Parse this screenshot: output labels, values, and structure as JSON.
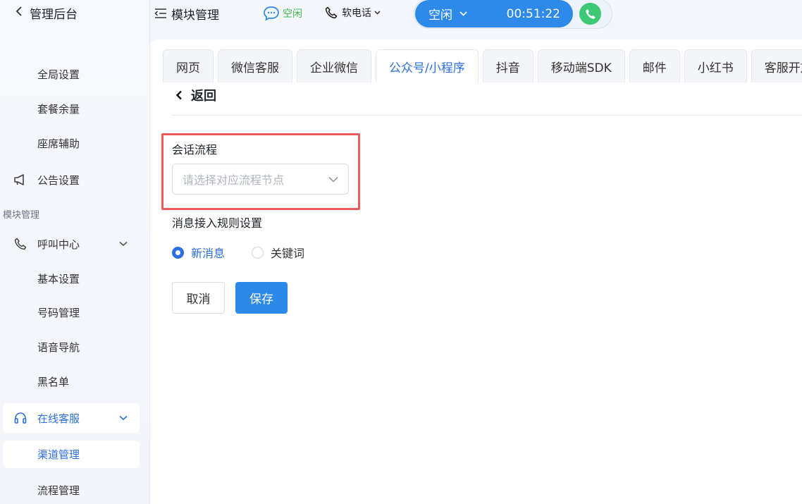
{
  "sidebar": {
    "back_label": "管理后台",
    "items": [
      {
        "label": "全局设置"
      },
      {
        "label": "套餐余量"
      },
      {
        "label": "座席辅助"
      },
      {
        "label": "公告设置",
        "icon": "megaphone-icon"
      }
    ],
    "section_label": "模块管理",
    "call_center": {
      "label": "呼叫中心",
      "icon": "phone-icon"
    },
    "call_center_items": [
      {
        "label": "基本设置"
      },
      {
        "label": "号码管理"
      },
      {
        "label": "语音导航"
      },
      {
        "label": "黑名单"
      }
    ],
    "online_service": {
      "label": "在线客服",
      "icon": "headset-icon"
    },
    "online_service_items": [
      {
        "label": "渠道管理"
      },
      {
        "label": "流程管理"
      }
    ]
  },
  "topbar": {
    "module_title": "模块管理",
    "status": "空闲",
    "softphone": "软电话",
    "call_state": "空闲",
    "call_timer": "00:51:22"
  },
  "tabs": [
    {
      "label": "网页"
    },
    {
      "label": "微信客服"
    },
    {
      "label": "企业微信"
    },
    {
      "label": "公众号/小程序",
      "active": true
    },
    {
      "label": "抖音"
    },
    {
      "label": "移动端SDK"
    },
    {
      "label": "邮件"
    },
    {
      "label": "小红书"
    },
    {
      "label": "客服开放"
    }
  ],
  "form": {
    "back_label": "返回",
    "session_flow_label": "会话流程",
    "session_flow_placeholder": "请选择对应流程节点",
    "rule_label": "消息接入规则设置",
    "radio_options": [
      {
        "label": "新消息",
        "checked": true
      },
      {
        "label": "关键词",
        "checked": false
      }
    ],
    "cancel_label": "取消",
    "save_label": "保存"
  },
  "colors": {
    "accent": "#2b8ae8",
    "active_text": "#2b6fe0",
    "highlight_border": "#ee5a5a",
    "status_green": "#3fb950",
    "call_button": "#3cc874"
  }
}
